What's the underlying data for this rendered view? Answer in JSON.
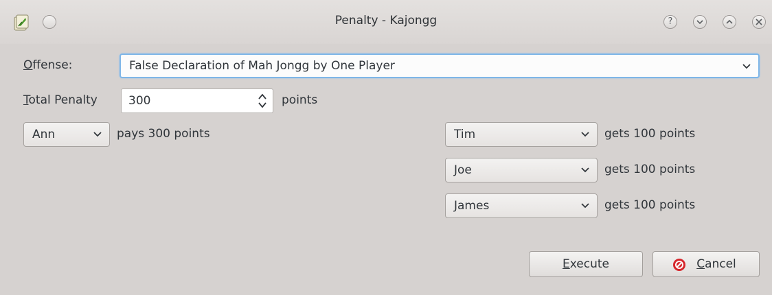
{
  "window": {
    "title": "Penalty - Kajongg",
    "titlebar_buttons": [
      "help",
      "minimize",
      "maximize",
      "close"
    ]
  },
  "offense": {
    "label": "Offense:",
    "value": "False Declaration of Mah Jongg by One Player"
  },
  "total_penalty": {
    "label": "Total Penalty",
    "value": "300",
    "unit": "points"
  },
  "payer": {
    "name": "Ann",
    "text": "pays 300 points"
  },
  "payees": [
    {
      "name": "Tim",
      "text": "gets 100 points"
    },
    {
      "name": "Joe",
      "text": "gets 100 points"
    },
    {
      "name": "James",
      "text": "gets 100 points"
    }
  ],
  "buttons": {
    "execute": "Execute",
    "cancel": "Cancel"
  },
  "colors": {
    "background": "#d6d2d0",
    "focus_border": "#7eb6e8",
    "cancel_icon": "#d7262c"
  },
  "icons": {
    "app": "kajongg-app-icon",
    "sticky": "pin-icon",
    "help": "help-icon",
    "minimize": "minimize-icon",
    "maximize": "maximize-icon",
    "close": "close-icon",
    "cancel": "cancel-icon"
  }
}
